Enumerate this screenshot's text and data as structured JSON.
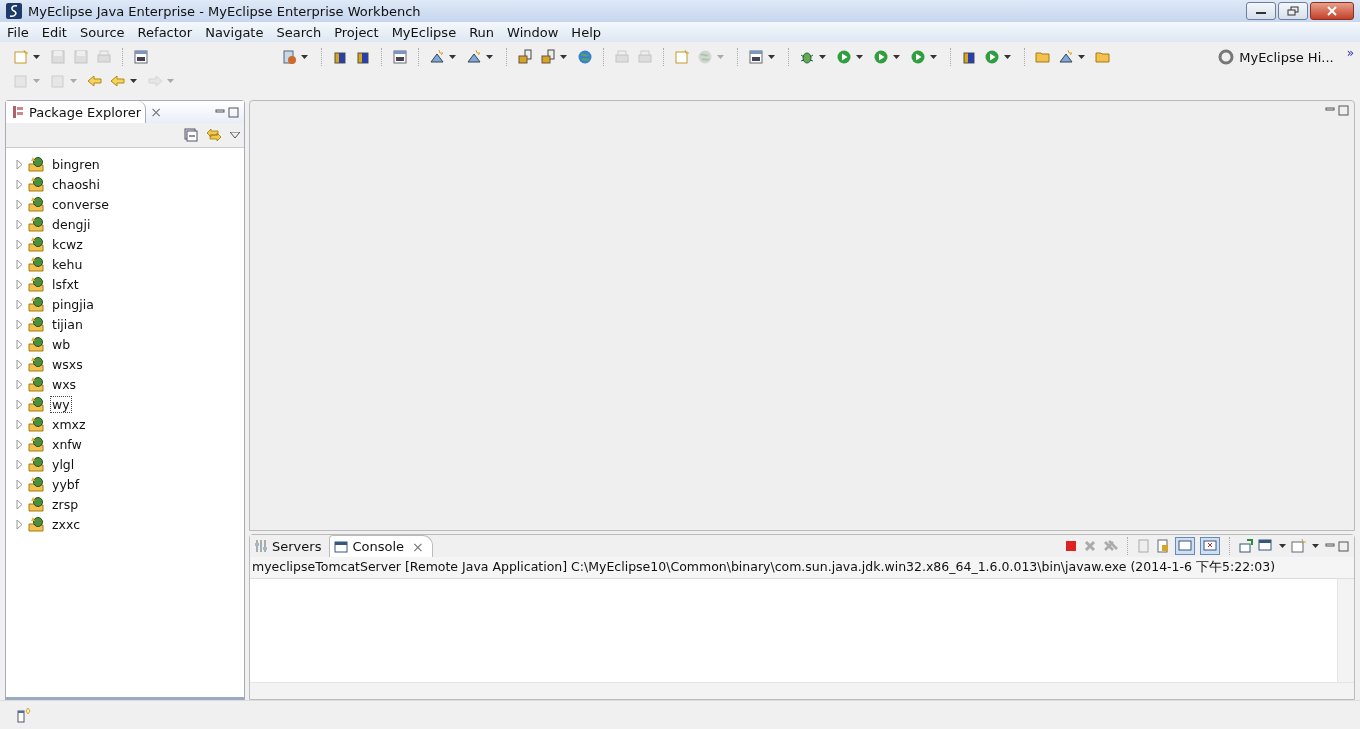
{
  "window": {
    "title": "MyEclipse Java Enterprise - MyEclipse Enterprise Workbench"
  },
  "menu": [
    "File",
    "Edit",
    "Source",
    "Refactor",
    "Navigate",
    "Search",
    "Project",
    "MyEclipse",
    "Run",
    "Window",
    "Help"
  ],
  "toolbar_row_1": [
    {
      "kind": "new",
      "disabled": false,
      "dropdown": true
    },
    {
      "kind": "save",
      "disabled": true,
      "dropdown": false
    },
    {
      "kind": "save",
      "disabled": true,
      "dropdown": false
    },
    {
      "kind": "print",
      "disabled": true,
      "dropdown": false
    },
    {
      "kind": "sep"
    },
    {
      "kind": "binary",
      "disabled": false,
      "dropdown": false
    },
    {
      "kind": "gap"
    },
    {
      "kind": "server",
      "disabled": false,
      "dropdown": true
    },
    {
      "kind": "sep"
    },
    {
      "kind": "box",
      "disabled": false,
      "dropdown": false
    },
    {
      "kind": "box",
      "disabled": false,
      "dropdown": false
    },
    {
      "kind": "sep"
    },
    {
      "kind": "binary",
      "disabled": false,
      "dropdown": false
    },
    {
      "kind": "sep"
    },
    {
      "kind": "wizard",
      "disabled": false,
      "dropdown": true
    },
    {
      "kind": "wizard",
      "disabled": false,
      "dropdown": true
    },
    {
      "kind": "sep"
    },
    {
      "kind": "deploy",
      "disabled": false,
      "dropdown": false
    },
    {
      "kind": "deploy",
      "disabled": false,
      "dropdown": true
    },
    {
      "kind": "globe",
      "disabled": false,
      "dropdown": false
    },
    {
      "kind": "sep"
    },
    {
      "kind": "print",
      "disabled": true,
      "dropdown": false
    },
    {
      "kind": "print",
      "disabled": true,
      "dropdown": false
    },
    {
      "kind": "sep"
    },
    {
      "kind": "new",
      "disabled": false,
      "dropdown": false
    },
    {
      "kind": "globe",
      "disabled": true,
      "dropdown": true
    },
    {
      "kind": "sep"
    },
    {
      "kind": "binary",
      "disabled": false,
      "dropdown": true
    },
    {
      "kind": "sep"
    },
    {
      "kind": "bug",
      "disabled": false,
      "dropdown": true
    },
    {
      "kind": "run",
      "disabled": false,
      "dropdown": true
    },
    {
      "kind": "run",
      "disabled": false,
      "dropdown": true
    },
    {
      "kind": "run",
      "disabled": false,
      "dropdown": true
    },
    {
      "kind": "sep"
    },
    {
      "kind": "box",
      "disabled": false,
      "dropdown": false
    },
    {
      "kind": "run",
      "disabled": false,
      "dropdown": true
    },
    {
      "kind": "sep"
    },
    {
      "kind": "folder",
      "disabled": false,
      "dropdown": false
    },
    {
      "kind": "wizard",
      "disabled": false,
      "dropdown": true
    },
    {
      "kind": "folder",
      "disabled": false,
      "dropdown": false
    }
  ],
  "toolbar_row_2": [
    {
      "kind": "new",
      "disabled": true,
      "dropdown": true
    },
    {
      "kind": "new",
      "disabled": true,
      "dropdown": true
    },
    {
      "kind": "back",
      "disabled": false,
      "dropdown": false
    },
    {
      "kind": "back",
      "disabled": false,
      "dropdown": true
    },
    {
      "kind": "forward",
      "disabled": true,
      "dropdown": true
    }
  ],
  "perspective": {
    "label": "MyEclipse Hi...",
    "more": "»"
  },
  "package_explorer": {
    "tab": {
      "label": "Package Explorer",
      "selected": true,
      "close": "×"
    },
    "projects": [
      {
        "name": "bingren",
        "expanded": false,
        "selected": false
      },
      {
        "name": "chaoshi",
        "expanded": false,
        "selected": false
      },
      {
        "name": "converse",
        "expanded": false,
        "selected": false
      },
      {
        "name": "dengji",
        "expanded": false,
        "selected": false
      },
      {
        "name": "kcwz",
        "expanded": false,
        "selected": false
      },
      {
        "name": "kehu",
        "expanded": false,
        "selected": false
      },
      {
        "name": "lsfxt",
        "expanded": false,
        "selected": false
      },
      {
        "name": "pingjia",
        "expanded": false,
        "selected": false
      },
      {
        "name": "tijian",
        "expanded": false,
        "selected": false
      },
      {
        "name": "wb",
        "expanded": false,
        "selected": false
      },
      {
        "name": "wsxs",
        "expanded": false,
        "selected": false
      },
      {
        "name": "wxs",
        "expanded": false,
        "selected": false
      },
      {
        "name": "wy",
        "expanded": false,
        "selected": true
      },
      {
        "name": "xmxz",
        "expanded": false,
        "selected": false
      },
      {
        "name": "xnfw",
        "expanded": false,
        "selected": false
      },
      {
        "name": "ylgl",
        "expanded": false,
        "selected": false
      },
      {
        "name": "yybf",
        "expanded": false,
        "selected": false
      },
      {
        "name": "zrsp",
        "expanded": false,
        "selected": false
      },
      {
        "name": "zxxc",
        "expanded": false,
        "selected": false
      }
    ]
  },
  "bottom_panel": {
    "tabs": [
      {
        "label": "Servers",
        "selected": false
      },
      {
        "label": "Console",
        "selected": true
      }
    ],
    "close": "×",
    "console_header": "myeclipseTomcatServer [Remote Java Application] C:\\MyEclipse10\\Common\\binary\\com.sun.java.jdk.win32.x86_64_1.6.0.013\\bin\\javaw.exe (2014-1-6 下午5:22:03)"
  }
}
